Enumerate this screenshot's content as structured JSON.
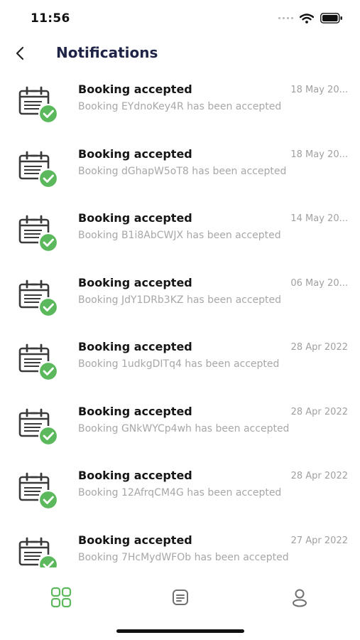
{
  "status_bar": {
    "time": "11:56"
  },
  "header": {
    "title": "Notifications",
    "back_icon": "chevron-left-icon"
  },
  "notifications": [
    {
      "title": "Booking accepted",
      "message": "Booking EYdnoKey4R has been accepted",
      "date": "18 May 20..."
    },
    {
      "title": "Booking accepted",
      "message": "Booking dGhapW5oT8 has been accepted",
      "date": "18 May 20..."
    },
    {
      "title": "Booking accepted",
      "message": "Booking B1i8AbCWJX has been accepted",
      "date": "14 May 20..."
    },
    {
      "title": "Booking accepted",
      "message": "Booking JdY1DRb3KZ has been accepted",
      "date": "06 May 20..."
    },
    {
      "title": "Booking accepted",
      "message": "Booking 1udkgDITq4 has been accepted",
      "date": "28 Apr 2022"
    },
    {
      "title": "Booking accepted",
      "message": "Booking GNkWYCp4wh has been accepted",
      "date": "28 Apr 2022"
    },
    {
      "title": "Booking accepted",
      "message": "Booking 12AfrqCM4G has been accepted",
      "date": "28 Apr 2022"
    },
    {
      "title": "Booking accepted",
      "message": "Booking 7HcMydWFOb has been accepted",
      "date": "27 Apr 2022"
    }
  ],
  "bottom_nav": {
    "items": [
      {
        "icon": "grid-icon",
        "active": true
      },
      {
        "icon": "document-icon",
        "active": false
      },
      {
        "icon": "profile-icon",
        "active": false
      }
    ]
  },
  "colors": {
    "accent_green": "#5cb85c",
    "title_navy": "#1f2447",
    "muted_text": "#a7a7a7"
  }
}
